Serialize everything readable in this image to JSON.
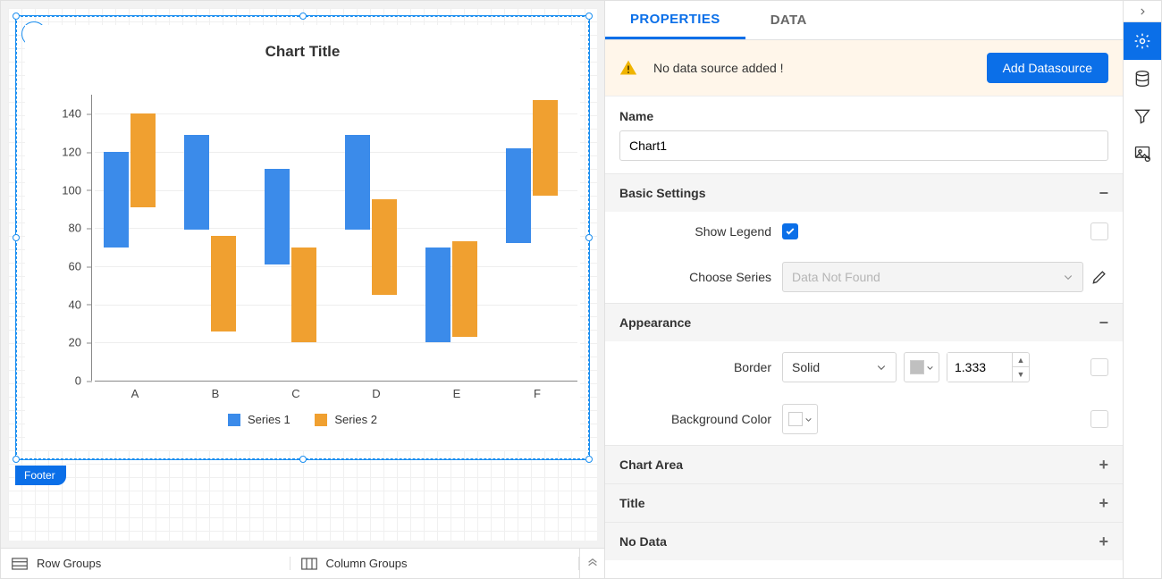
{
  "chart_data": {
    "type": "range-bar",
    "title": "Chart Title",
    "categories": [
      "A",
      "B",
      "C",
      "D",
      "E",
      "F"
    ],
    "series": [
      {
        "name": "Series 1",
        "color": "#3b8bea",
        "values": [
          {
            "low": 70,
            "high": 120
          },
          {
            "low": 79,
            "high": 129
          },
          {
            "low": 61,
            "high": 111
          },
          {
            "low": 79,
            "high": 129
          },
          {
            "low": 20,
            "high": 70
          },
          {
            "low": 72,
            "high": 122
          }
        ]
      },
      {
        "name": "Series 2",
        "color": "#f0a030",
        "values": [
          {
            "low": 91,
            "high": 140
          },
          {
            "low": 26,
            "high": 76
          },
          {
            "low": 20,
            "high": 70
          },
          {
            "low": 45,
            "high": 95
          },
          {
            "low": 23,
            "high": 73
          },
          {
            "low": 97,
            "high": 147
          }
        ]
      }
    ],
    "xlabel": "",
    "ylabel": "",
    "ylim": [
      0,
      150
    ],
    "y_ticks": [
      0,
      20,
      40,
      60,
      80,
      100,
      120,
      140
    ],
    "legend_position": "bottom",
    "grid": true
  },
  "canvas": {
    "footer_tag": "Footer"
  },
  "groups_bar": {
    "row_groups": "Row Groups",
    "column_groups": "Column Groups"
  },
  "panel": {
    "tabs": {
      "properties": "PROPERTIES",
      "data": "DATA"
    },
    "alert": {
      "text": "No data source added !",
      "button": "Add Datasource"
    },
    "name_label": "Name",
    "name_value": "Chart1",
    "basic_settings": {
      "title": "Basic Settings",
      "show_legend_label": "Show Legend",
      "show_legend_checked": true,
      "choose_series_label": "Choose Series",
      "choose_series_value": "Data Not Found"
    },
    "appearance": {
      "title": "Appearance",
      "border_label": "Border",
      "border_style": "Solid",
      "border_width": "1.333",
      "background_label": "Background Color"
    },
    "collapsed_sections": {
      "chart_area": "Chart Area",
      "title": "Title",
      "no_data": "No Data"
    }
  }
}
